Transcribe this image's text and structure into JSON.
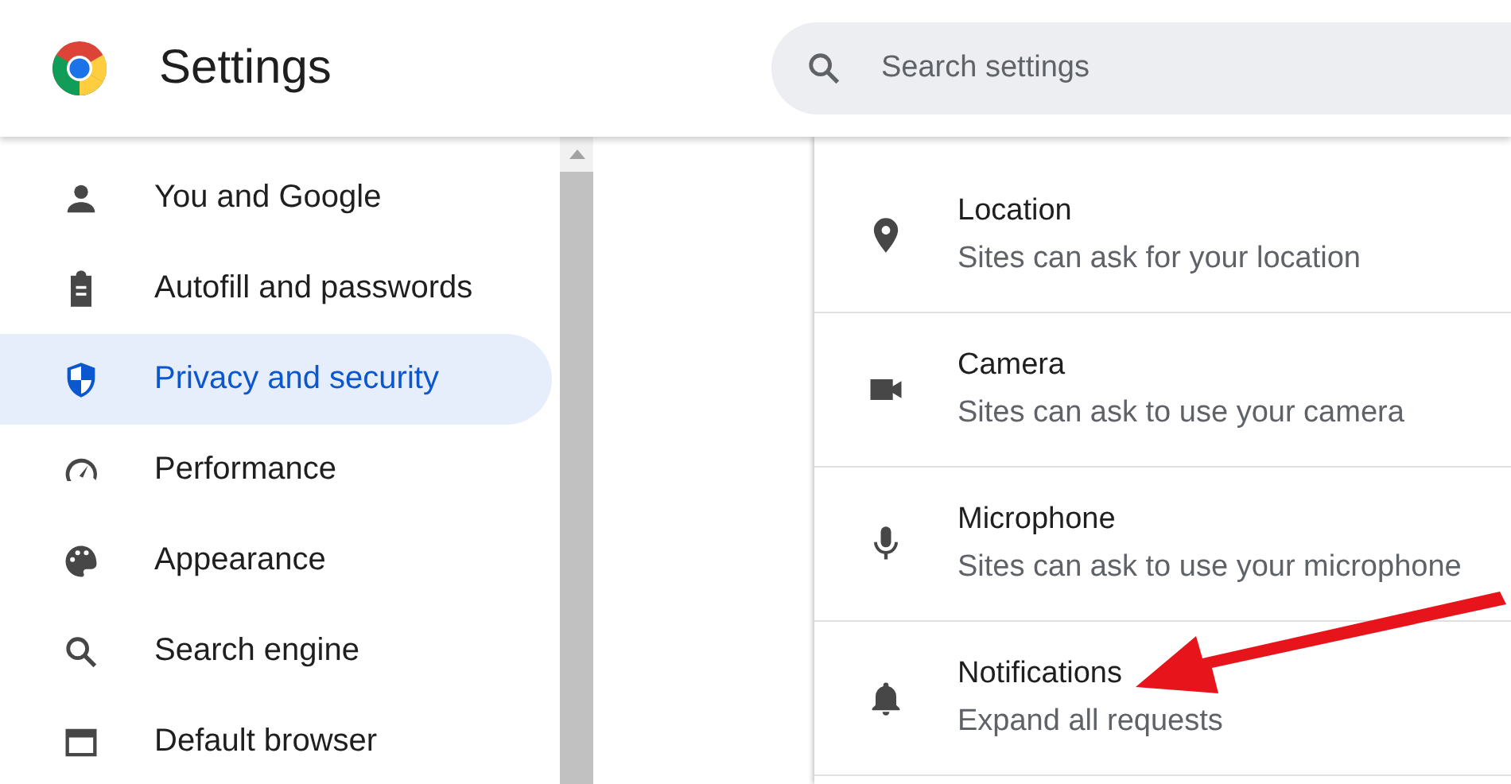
{
  "header": {
    "title": "Settings",
    "search": {
      "placeholder": "Search settings"
    }
  },
  "sidebar": {
    "items": [
      {
        "label": "You and Google",
        "kind": "person",
        "selected": false
      },
      {
        "label": "Autofill and passwords",
        "kind": "clipboard",
        "selected": false
      },
      {
        "label": "Privacy and security",
        "kind": "shield",
        "selected": true
      },
      {
        "label": "Performance",
        "kind": "gauge",
        "selected": false
      },
      {
        "label": "Appearance",
        "kind": "palette",
        "selected": false
      },
      {
        "label": "Search engine",
        "kind": "search",
        "selected": false
      },
      {
        "label": "Default browser",
        "kind": "browser",
        "selected": false
      }
    ]
  },
  "permissions": [
    {
      "title": "Location",
      "subtitle": "Sites can ask for your location",
      "kind": "pin"
    },
    {
      "title": "Camera",
      "subtitle": "Sites can ask to use your camera",
      "kind": "camera"
    },
    {
      "title": "Microphone",
      "subtitle": "Sites can ask to use your microphone",
      "kind": "mic"
    },
    {
      "title": "Notifications",
      "subtitle": "Expand all requests",
      "kind": "bell"
    }
  ]
}
